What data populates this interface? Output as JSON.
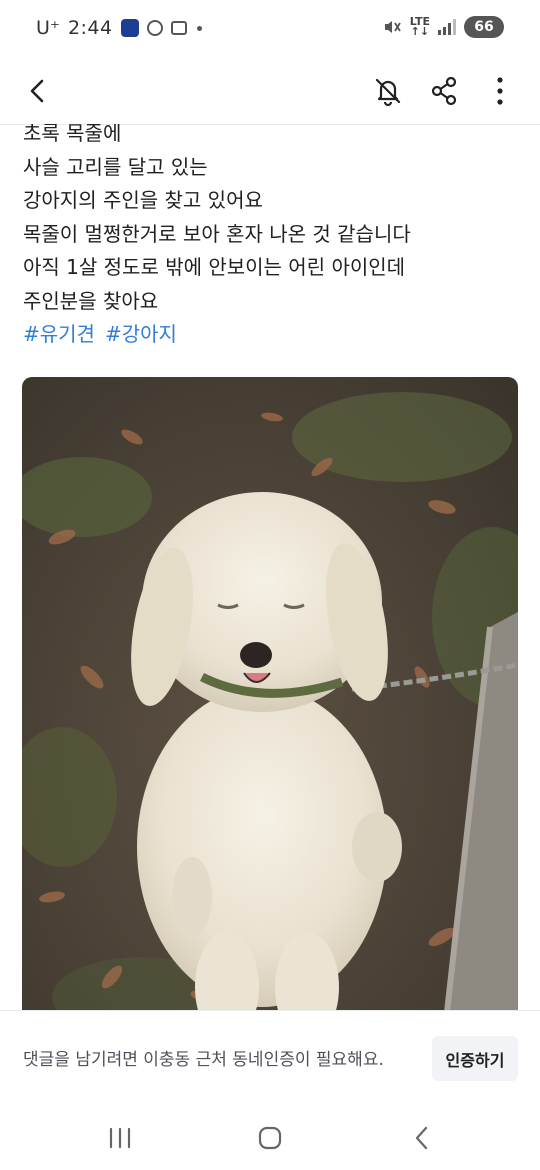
{
  "status_bar": {
    "carrier": "U⁺",
    "time": "2:44",
    "network": "LTE",
    "battery": "66",
    "icons": [
      "app-notification-icon",
      "do-not-disturb-icon",
      "screenshot-icon",
      "more-notifications-dot",
      "mute-icon",
      "lte-icon",
      "signal-icon",
      "battery-icon"
    ]
  },
  "app_bar": {
    "icons": [
      "back-arrow-icon",
      "notification-off-icon",
      "share-icon",
      "more-vertical-icon"
    ]
  },
  "post": {
    "lines": [
      "초록 목줄에",
      "사슬 고리를 달고 있는",
      "강아지의 주인을 찾고 있어요",
      "목줄이 멀쩡한거로 보아 혼자 나온 것 같습니다",
      "아직 1살 정도로 밖에 안보이는 어린 아이인데",
      "주인분을 찾아요"
    ],
    "hashtags": [
      "#유기견",
      "#강아지"
    ],
    "hashtag_color": "#2f7ed8"
  },
  "comment_bar": {
    "notice": "댓글을 남기려면 이충동 근처 동네인증이 필요해요.",
    "verify_button": "인증하기"
  },
  "nav_bar": {
    "icons": [
      "recent-apps-icon",
      "home-icon",
      "back-icon"
    ]
  }
}
